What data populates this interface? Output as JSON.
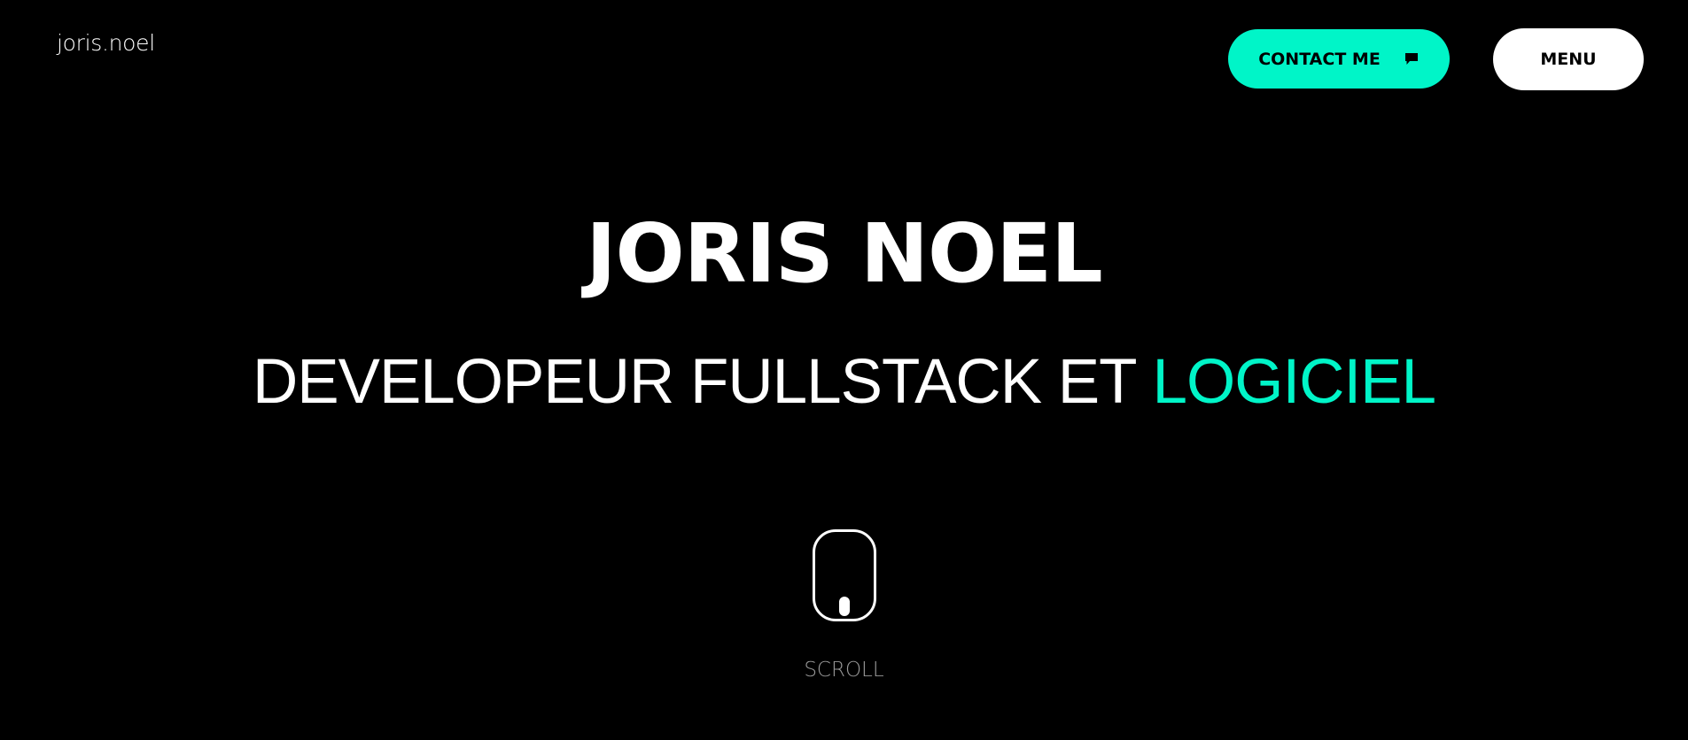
{
  "header": {
    "logo_text": "joris.noel",
    "contact_label": "CONTACT ME",
    "contact_icon": "chat-bubble-icon",
    "menu_label": "MENU"
  },
  "hero": {
    "title": "JORIS NOEL",
    "subtitle_main": "DEVELOPEUR FULLSTACK ET",
    "subtitle_accent": "LOGICIEL"
  },
  "scroll": {
    "icon": "mouse-icon",
    "label": "SCROLL"
  },
  "colors": {
    "background": "#000000",
    "accent": "#00f5c8",
    "text": "#ffffff",
    "muted": "#9a9a9a"
  }
}
